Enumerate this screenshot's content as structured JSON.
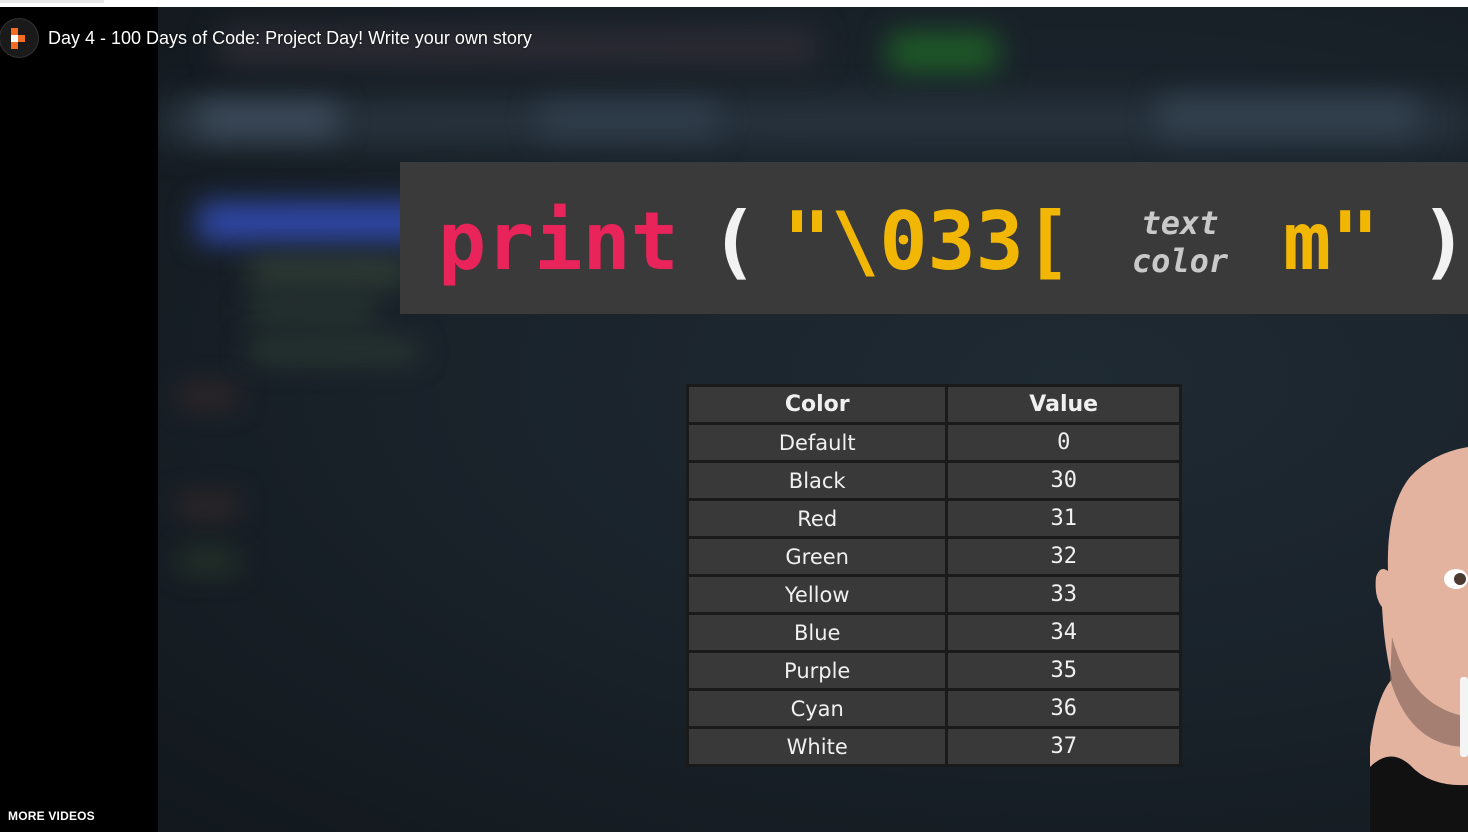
{
  "player": {
    "title": "Day 4 - 100 Days of Code: Project Day! Write your own story",
    "channel_avatar_icon": "channel-logo-icon",
    "more_videos_label": "MORE VIDEOS"
  },
  "slide": {
    "code": {
      "kw": "print",
      "open_paren": "(",
      "str_open": "\"\\033[",
      "hint_line1": "text",
      "hint_line2": "color",
      "str_close": "m\"",
      "close_paren": ")"
    },
    "table": {
      "headers": [
        "Color",
        "Value"
      ],
      "rows": [
        [
          "Default",
          "0"
        ],
        [
          "Black",
          "30"
        ],
        [
          "Red",
          "31"
        ],
        [
          "Green",
          "32"
        ],
        [
          "Yellow",
          "33"
        ],
        [
          "Blue",
          "34"
        ],
        [
          "Purple",
          "35"
        ],
        [
          "Cyan",
          "36"
        ],
        [
          "White",
          "37"
        ]
      ]
    },
    "colors": {
      "keyword": "#e8245a",
      "string": "#f2b705",
      "banner": "#3a3a3a",
      "table_cell": "#393939"
    }
  }
}
